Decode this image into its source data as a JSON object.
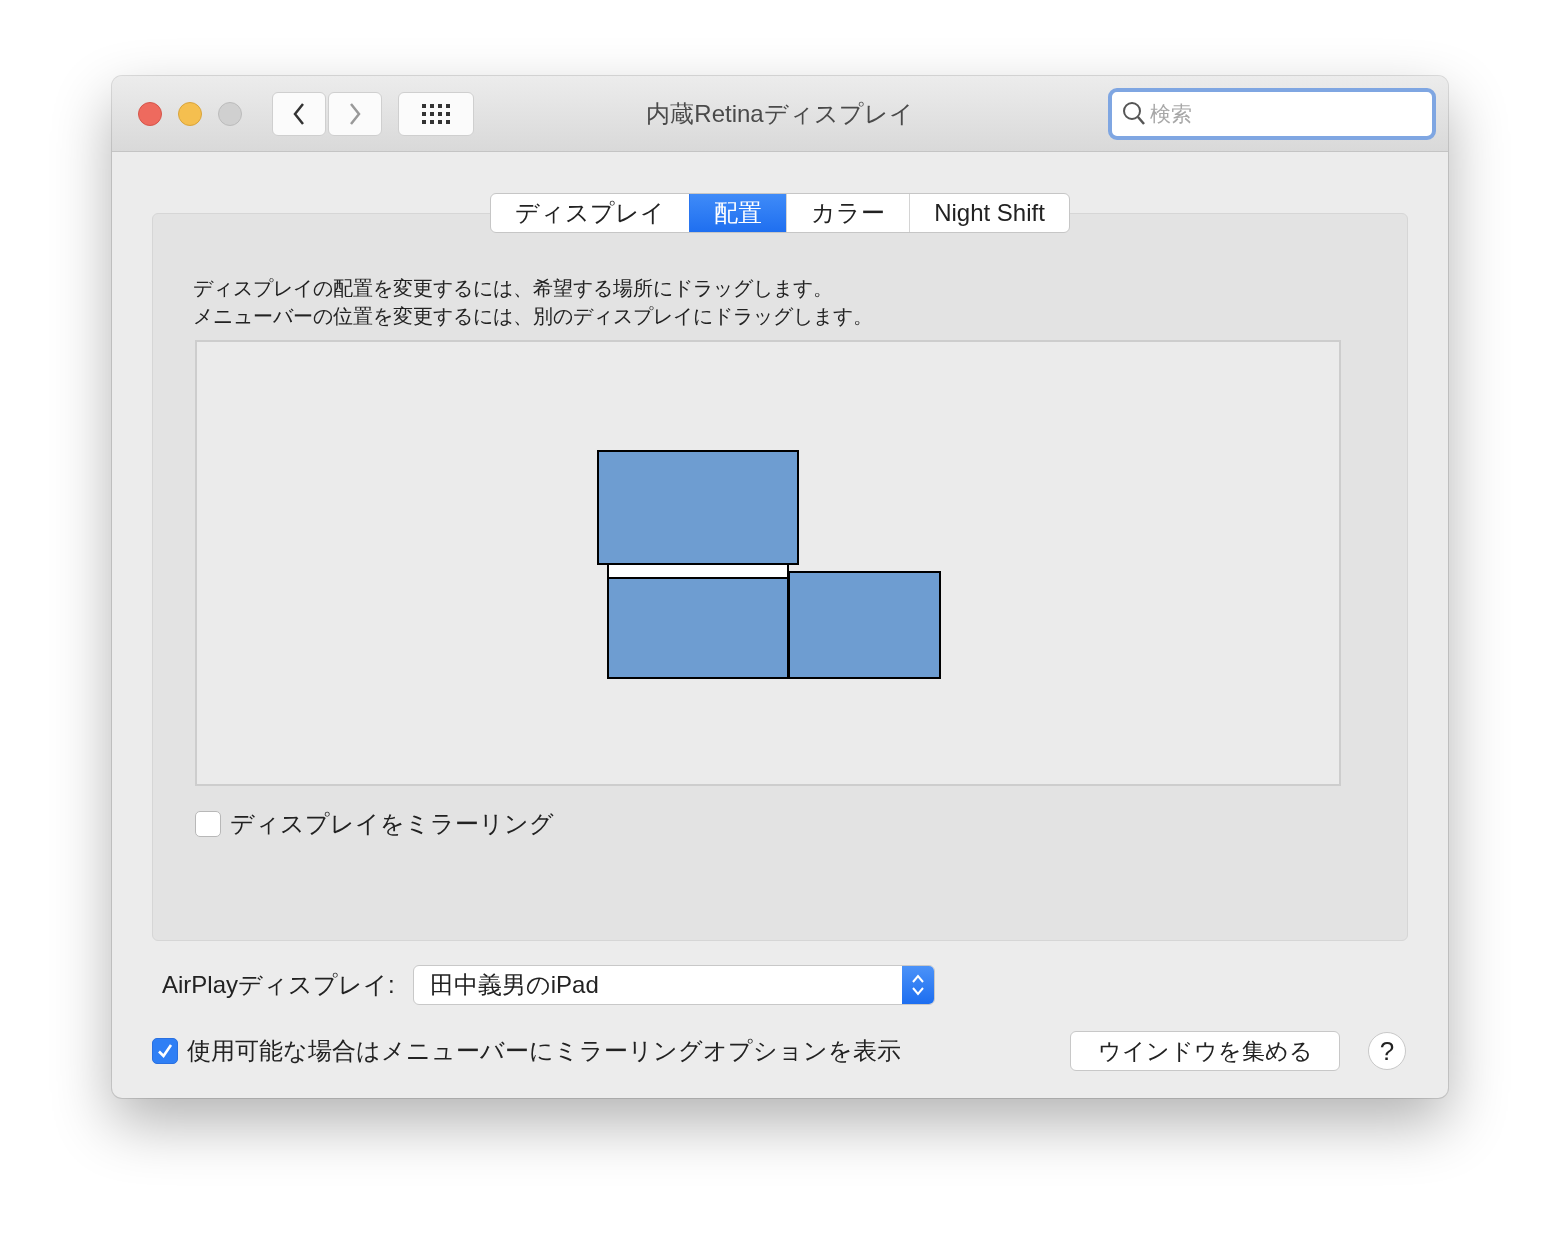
{
  "window": {
    "title": "内蔵Retinaディスプレイ",
    "search": {
      "placeholder": "検索"
    }
  },
  "tabs": [
    {
      "label": "ディスプレイ",
      "selected": false
    },
    {
      "label": "配置",
      "selected": true
    },
    {
      "label": "カラー",
      "selected": false
    },
    {
      "label": "Night Shift",
      "selected": false
    }
  ],
  "instructions": [
    "ディスプレイの配置を変更するには、希望する場所にドラッグします。",
    "メニューバーの位置を変更するには、別のディスプレイにドラッグします。"
  ],
  "arrangement": {
    "displays": [
      {
        "menu_bar": false
      },
      {
        "menu_bar": true
      },
      {
        "menu_bar": false
      }
    ]
  },
  "mirror_displays": {
    "label": "ディスプレイをミラーリング",
    "checked": false
  },
  "airplay": {
    "label": "AirPlayディスプレイ:",
    "value": "田中義男のiPad"
  },
  "show_mirroring_options": {
    "label": "使用可能な場合はメニューバーにミラーリングオプションを表示",
    "checked": true
  },
  "gather_windows_button": "ウインドウを集める",
  "help_button": "?"
}
